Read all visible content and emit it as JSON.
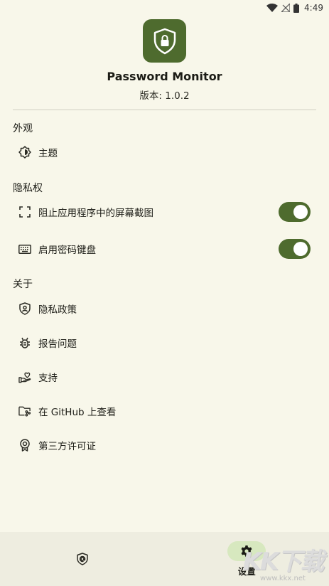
{
  "status_bar": {
    "time": "4:49"
  },
  "app": {
    "title": "Password Monitor",
    "version": "版本: 1.0.2",
    "accent_color": "#4e6b2e"
  },
  "sections": {
    "appearance": {
      "title": "外观",
      "items": [
        {
          "label": "主题",
          "icon": "theme-icon"
        }
      ]
    },
    "privacy": {
      "title": "隐私权",
      "items": [
        {
          "label": "阻止应用程序中的屏幕截图",
          "icon": "screenshot-frame-icon",
          "enabled": true
        },
        {
          "label": "启用密码键盘",
          "icon": "keyboard-icon",
          "enabled": true
        }
      ]
    },
    "about": {
      "title": "关于",
      "items": [
        {
          "label": "隐私政策",
          "icon": "privacy-shield-icon"
        },
        {
          "label": "报告问题",
          "icon": "bug-icon"
        },
        {
          "label": "支持",
          "icon": "hand-heart-icon"
        },
        {
          "label": "在 GitHub 上查看",
          "icon": "github-folder-icon"
        },
        {
          "label": "第三方许可证",
          "icon": "license-badge-icon"
        }
      ]
    }
  },
  "bottom_nav": {
    "items": [
      {
        "label": "",
        "icon": "shield-at-icon",
        "active": false
      },
      {
        "label": "设置",
        "icon": "gear-icon",
        "active": true
      }
    ]
  },
  "watermark": {
    "text": "KK下载",
    "url": "www.kkx.net"
  }
}
